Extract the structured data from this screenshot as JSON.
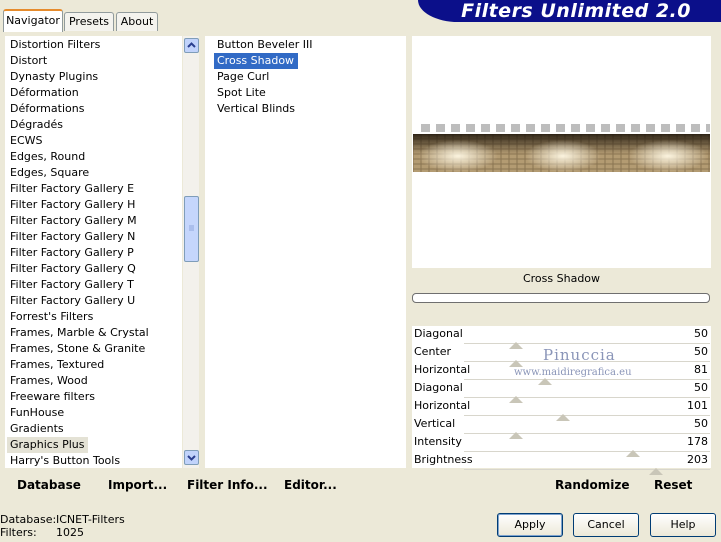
{
  "tabs": [
    {
      "label": "Navigator"
    },
    {
      "label": "Presets"
    },
    {
      "label": "About"
    }
  ],
  "app_title": "Filters Unlimited 2.0",
  "categories": [
    "Distortion Filters",
    "Distort",
    "Dynasty Plugins",
    "Déformation",
    "Déformations",
    "Dégradés",
    "ECWS",
    "Edges, Round",
    "Edges, Square",
    "Filter Factory Gallery E",
    "Filter Factory Gallery H",
    "Filter Factory Gallery M",
    "Filter Factory Gallery N",
    "Filter Factory Gallery P",
    "Filter Factory Gallery Q",
    "Filter Factory Gallery T",
    "Filter Factory Gallery U",
    "Forrest's Filters",
    "Frames, Marble & Crystal",
    "Frames, Stone & Granite",
    "Frames, Textured",
    "Frames, Wood",
    "Freeware filters",
    "FunHouse",
    "Gradients",
    "Graphics Plus",
    "Harry's Button Tools"
  ],
  "selected_category": "Graphics Plus",
  "filters": [
    "Button Beveler III",
    "Cross Shadow",
    "Page Curl",
    "Spot Lite",
    "Vertical Blinds"
  ],
  "selected_filter": "Cross Shadow",
  "filter_name": "Cross Shadow",
  "sliders": [
    {
      "label": "Diagonal",
      "value": "50",
      "level": 50
    },
    {
      "label": "Center",
      "value": "50",
      "level": 50
    },
    {
      "label": "Horizontal",
      "value": "81",
      "level": 81
    },
    {
      "label": "Diagonal",
      "value": "50",
      "level": 50
    },
    {
      "label": "Horizontal",
      "value": "101",
      "level": 101
    },
    {
      "label": "Vertical",
      "value": "50",
      "level": 50
    },
    {
      "label": "Intensity",
      "value": "178",
      "level": 178
    },
    {
      "label": "Brightness",
      "value": "203",
      "level": 203
    }
  ],
  "watermark": {
    "line1": "Pinuccia",
    "line2": "www.maidiregrafica.eu"
  },
  "toolbar": {
    "database": "Database",
    "import": "Import...",
    "filter_info": "Filter Info...",
    "editor": "Editor...",
    "randomize": "Randomize",
    "reset": "Reset"
  },
  "status": {
    "database_label": "Database:",
    "database_value": "ICNET-Filters",
    "filters_label": "Filters:",
    "filters_value": "1025"
  },
  "buttons": {
    "apply": "Apply",
    "cancel": "Cancel",
    "help": "Help"
  }
}
